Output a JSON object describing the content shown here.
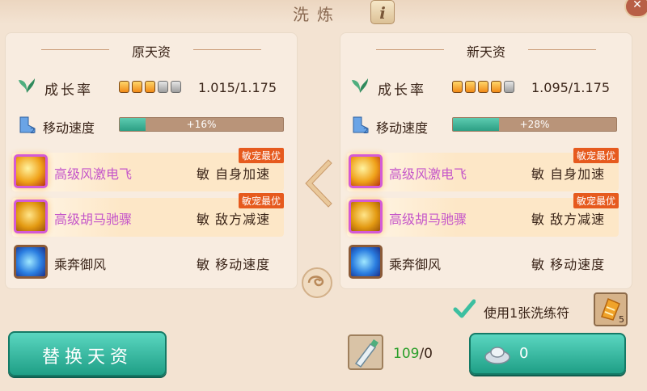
{
  "dialog": {
    "title": "洗炼",
    "info_icon_text": "i",
    "close_glyph": "✕"
  },
  "left_panel": {
    "header": "原天资",
    "growth": {
      "label": "成长率",
      "value": "1.015/1.175",
      "stars_filled": 3,
      "stars_total": 5
    },
    "speed": {
      "label": "移动速度",
      "bar_text": "+16%",
      "bar_fraction": 0.16
    },
    "skills": [
      {
        "name": "高级风激电飞",
        "desc": "敏 自身加速",
        "badge": "敏宠最优",
        "icon": "golden-wind-skill-icon"
      },
      {
        "name": "高级胡马驰骤",
        "desc": "敏 敌方减速",
        "badge": "敏宠最优",
        "icon": "golden-horse-skill-icon"
      },
      {
        "name": "乘奔御风",
        "desc": "敏 移动速度",
        "badge": "",
        "icon": "blue-wind-skill-icon"
      }
    ]
  },
  "right_panel": {
    "header": "新天资",
    "growth": {
      "label": "成长率",
      "value": "1.095/1.175",
      "stars_filled": 4,
      "stars_total": 5
    },
    "speed": {
      "label": "移动速度",
      "bar_text": "+28%",
      "bar_fraction": 0.28
    },
    "skills": [
      {
        "name": "高级风激电飞",
        "desc": "敏 自身加速",
        "badge": "敏宠最优",
        "icon": "golden-wind-skill-icon"
      },
      {
        "name": "高级胡马驰骤",
        "desc": "敏 敌方减速",
        "badge": "敏宠最优",
        "icon": "golden-horse-skill-icon"
      },
      {
        "name": "乘奔御风",
        "desc": "敏 移动速度",
        "badge": "",
        "icon": "blue-wind-skill-icon"
      }
    ]
  },
  "options": {
    "use_rune_label": "使用1张洗练符",
    "use_rune_checked": true,
    "rune_count": "5"
  },
  "resources": {
    "potion_owned": "109",
    "potion_sep_need": "/0",
    "silver_cost": "0"
  },
  "buttons": {
    "replace_label": "替换天资"
  },
  "colors": {
    "accent_green": "#2c9f84",
    "purple_skill": "#c556c9",
    "badge_orange": "#e65a1e",
    "panel_bg": "#f8ece0"
  }
}
